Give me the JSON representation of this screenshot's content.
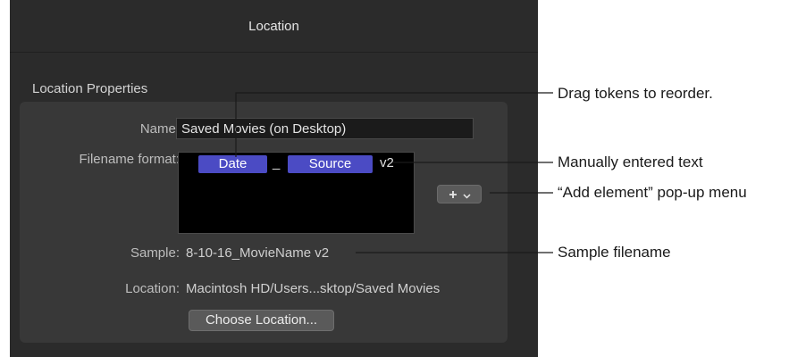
{
  "window": {
    "title": "Location"
  },
  "section": {
    "title": "Location Properties"
  },
  "fields": {
    "name_label": "Name:",
    "name_value": "Saved Movies (on Desktop)",
    "format_label": "Filename format:",
    "tokens": [
      "Date",
      "_",
      "Source",
      "v2"
    ],
    "add_button_icon": "plus-icon",
    "add_button_chevron": "chevron-down-icon",
    "sample_label": "Sample:",
    "sample_value": "8-10-16_MovieName v2",
    "location_label": "Location:",
    "location_value": "Macintosh HD/Users...sktop/Saved Movies",
    "choose_button": "Choose Location..."
  },
  "callouts": {
    "reorder": "Drag tokens to reorder.",
    "manual": "Manually entered text",
    "add_element": "“Add element” pop-up menu",
    "sample": "Sample filename"
  },
  "colors": {
    "panel_bg": "#2b2b2b",
    "inner_bg": "#383838",
    "token_bg": "#4b4bc4",
    "callout_line": "#1a1a1a"
  }
}
